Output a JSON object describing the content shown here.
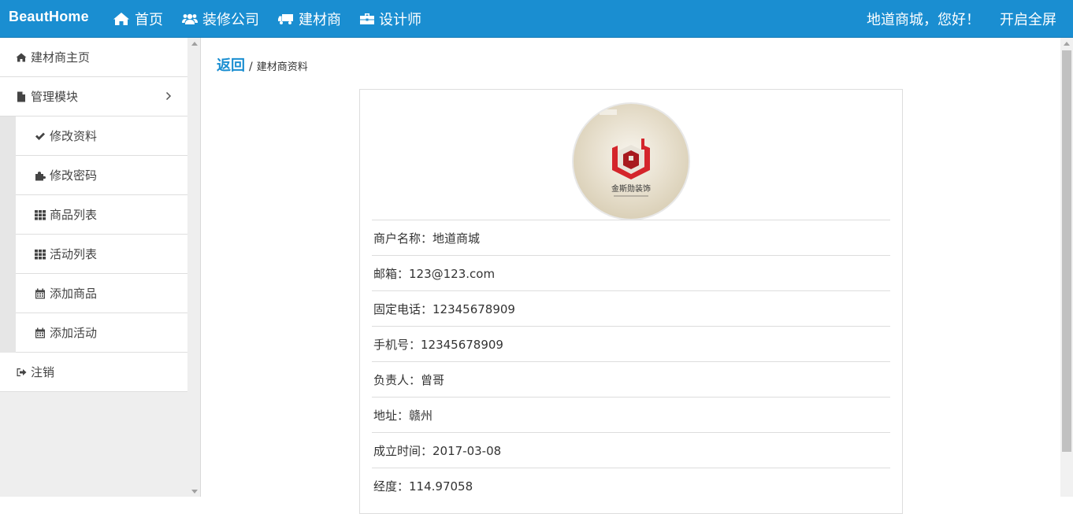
{
  "header": {
    "brand": "BeautHome",
    "nav": [
      {
        "label": "首页",
        "icon": "home-icon"
      },
      {
        "label": "装修公司",
        "icon": "users-icon"
      },
      {
        "label": "建材商",
        "icon": "truck-icon"
      },
      {
        "label": "设计师",
        "icon": "briefcase-icon"
      }
    ],
    "greeting": "地道商城，您好！",
    "fullscreen": "开启全屏"
  },
  "sidebar": {
    "home": {
      "label": "建材商主页",
      "icon": "home-icon"
    },
    "module": {
      "label": "管理模块",
      "icon": "file-icon"
    },
    "subitems": [
      {
        "label": "修改资料",
        "icon": "check-icon"
      },
      {
        "label": "修改密码",
        "icon": "puzzle-icon"
      },
      {
        "label": "商品列表",
        "icon": "grid-icon"
      },
      {
        "label": "活动列表",
        "icon": "grid-icon"
      },
      {
        "label": "添加商品",
        "icon": "calendar-icon"
      },
      {
        "label": "添加活动",
        "icon": "calendar-icon"
      }
    ],
    "logout": {
      "label": "注销",
      "icon": "sign-out-icon"
    }
  },
  "breadcrumb": {
    "back": "返回",
    "separator": "/",
    "current": "建材商资料"
  },
  "profile": {
    "logo_text": "金斯勋装饰",
    "logo_color": "#d4252b",
    "rows": [
      "商户名称：地道商城",
      "邮箱：123@123.com",
      "固定电话：12345678909",
      "手机号：12345678909",
      "负责人：曾哥",
      "地址：赣州",
      "成立时间：2017-03-08",
      "经度：114.97058"
    ]
  },
  "colors": {
    "primary": "#1a8ed1",
    "sidebar_bg": "#eeeeee"
  }
}
